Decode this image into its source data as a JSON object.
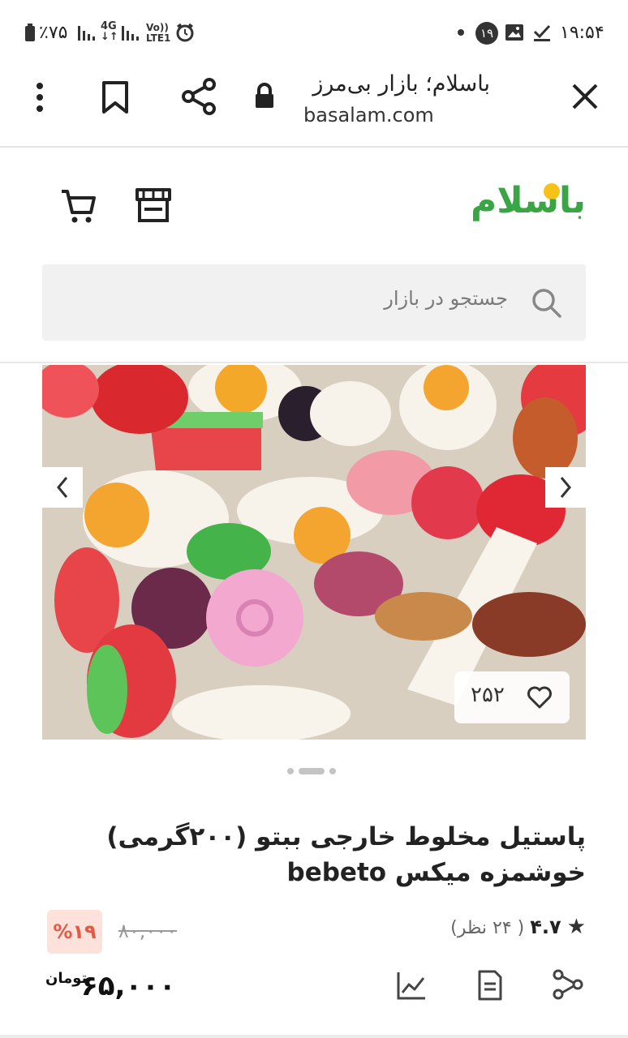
{
  "status_bar": {
    "time": "۱۹:۵۴",
    "battery": "٪۷۵",
    "network": "4G",
    "carrier_tag": "LTE1",
    "notification_count": "۱۹"
  },
  "browser": {
    "site_title": "باسلام؛ بازار بی‌مرز",
    "url": "basalam.com"
  },
  "header": {
    "logo_text": "باسلام",
    "search_placeholder": "جستجو در بازار"
  },
  "gallery": {
    "like_count": "۲۵۲",
    "active_slide": 2,
    "slide_count": 3
  },
  "product": {
    "title": "پاستیل مخلوط خارجی ببتو (۲۰۰گرمی) خوشمزه میکس bebeto",
    "rating_score": "۴.۷",
    "rating_count": "( ۲۴ نظر)",
    "discount": "%۱۹",
    "old_price": "۸۰,۰۰۰",
    "price": "۶۵,۰۰۰",
    "currency": "تومان"
  },
  "colors": {
    "brand_green": "#3aa545",
    "brand_yellow": "#f6c21a",
    "discount_bg": "#fde2dc",
    "discount_text": "#e05a45"
  }
}
